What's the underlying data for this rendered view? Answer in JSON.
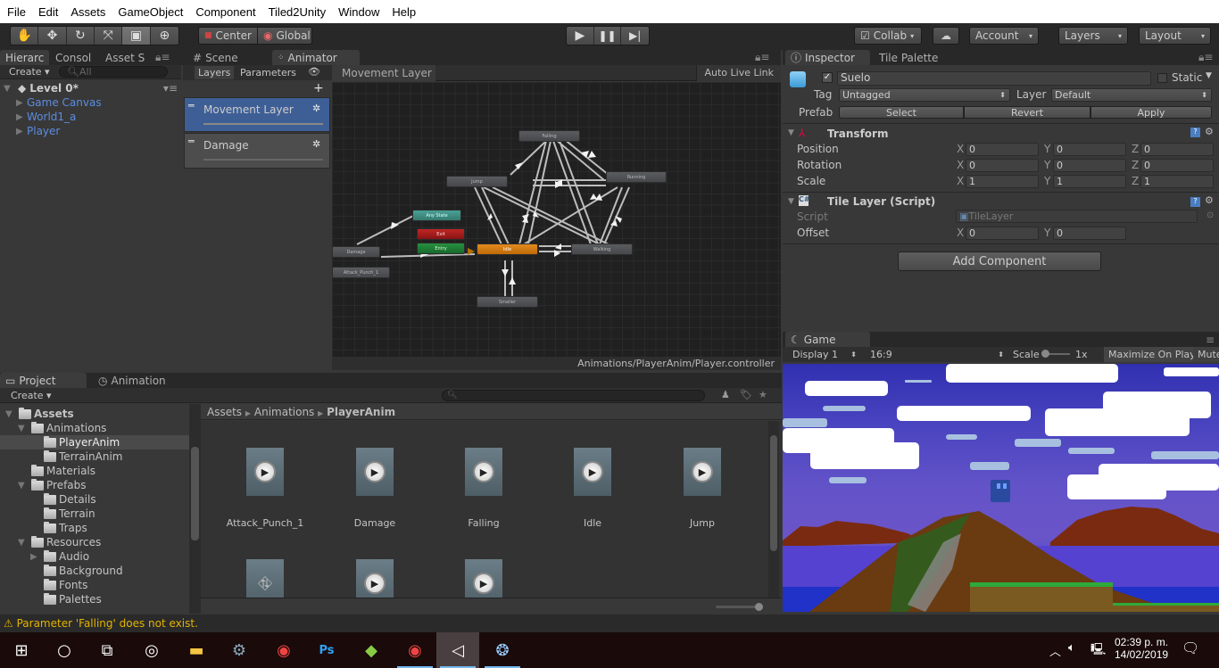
{
  "menu": [
    "File",
    "Edit",
    "Assets",
    "GameObject",
    "Component",
    "Tiled2Unity",
    "Window",
    "Help"
  ],
  "toolbar": {
    "tools": [
      "hand-tool",
      "move-tool",
      "rotate-tool",
      "scale-tool",
      "rect-tool",
      "transform-tool"
    ],
    "pivot_label": "Center",
    "space_label": "Global",
    "collab_label": "Collab",
    "account_label": "Account",
    "layers_label": "Layers",
    "layout_label": "Layout"
  },
  "hierarchy": {
    "tabs": [
      "Hierarc",
      "Consol",
      "Asset S"
    ],
    "create_label": "Create",
    "search_placeholder": "All",
    "scene_name": "Level 0*",
    "items": [
      "Game Canvas",
      "World1_a",
      "Player"
    ]
  },
  "animator": {
    "tabs": [
      "Scene",
      "Animator"
    ],
    "side_tabs": [
      "Layers",
      "Parameters"
    ],
    "layers": [
      {
        "name": "Movement Layer",
        "selected": true
      },
      {
        "name": "Damage",
        "selected": false
      }
    ],
    "breadcrumb": "Movement Layer",
    "auto_live_link": "Auto Live Link",
    "controller_path": "Animations/PlayerAnim/Player.controller",
    "states": {
      "falling": "Falling",
      "jump": "Jump",
      "running": "Running",
      "idle": "Idle",
      "walking": "Walking",
      "smaller": "Smaller",
      "any_state": "Any State",
      "exit": "Exit",
      "entry": "Entry",
      "damage": "Damage",
      "attack": "Attack_Punch_1"
    },
    "colors": {
      "default": "#4b4d50",
      "idle": "#d27a12",
      "any_state": "#3e8a80",
      "exit": "#a01c1c",
      "entry": "#1c7a30"
    }
  },
  "inspector": {
    "tabs": [
      "Inspector",
      "Tile Palette"
    ],
    "object_name": "Suelo",
    "active": true,
    "static_label": "Static",
    "tag_label": "Tag",
    "tag_value": "Untagged",
    "layer_label": "Layer",
    "layer_value": "Default",
    "prefab_label": "Prefab",
    "prefab_buttons": [
      "Select",
      "Revert",
      "Apply"
    ],
    "transform": {
      "title": "Transform",
      "rows": [
        {
          "label": "Position",
          "x": "0",
          "y": "0",
          "z": "0"
        },
        {
          "label": "Rotation",
          "x": "0",
          "y": "0",
          "z": "0"
        },
        {
          "label": "Scale",
          "x": "1",
          "y": "1",
          "z": "1"
        }
      ]
    },
    "tile_layer": {
      "title": "Tile Layer (Script)",
      "script_label": "Script",
      "script_value": "TileLayer",
      "offset_label": "Offset",
      "offset_x": "0",
      "offset_y": "0"
    },
    "add_component": "Add Component"
  },
  "game": {
    "tab": "Game",
    "display": "Display 1",
    "aspect": "16:9",
    "scale_label": "Scale",
    "scale_value": "1x",
    "maximize": "Maximize On Play",
    "mute": "Mute"
  },
  "project": {
    "tabs": [
      "Project",
      "Animation"
    ],
    "create_label": "Create",
    "tree": [
      {
        "label": "Assets",
        "depth": 0,
        "expanded": true,
        "bold": true
      },
      {
        "label": "Animations",
        "depth": 1,
        "expanded": true
      },
      {
        "label": "PlayerAnim",
        "depth": 2,
        "selected": true
      },
      {
        "label": "TerrainAnim",
        "depth": 2
      },
      {
        "label": "Materials",
        "depth": 1
      },
      {
        "label": "Prefabs",
        "depth": 1,
        "expanded": true
      },
      {
        "label": "Details",
        "depth": 2
      },
      {
        "label": "Terrain",
        "depth": 2
      },
      {
        "label": "Traps",
        "depth": 2
      },
      {
        "label": "Resources",
        "depth": 1,
        "expanded": true
      },
      {
        "label": "Audio",
        "depth": 2,
        "collapsed": true
      },
      {
        "label": "Background",
        "depth": 2
      },
      {
        "label": "Fonts",
        "depth": 2
      },
      {
        "label": "Palettes",
        "depth": 2
      }
    ],
    "breadcrumb": [
      "Assets",
      "Animations",
      "PlayerAnim"
    ],
    "assets": [
      "Attack_Punch_1",
      "Damage",
      "Falling",
      "Idle",
      "Jump"
    ],
    "assets_row2": [
      "animator-controller",
      "animation-clip",
      "animation-clip"
    ]
  },
  "status": {
    "warning": "Parameter 'Falling' does not exist."
  },
  "taskbar": {
    "apps": [
      "start",
      "cortana-search",
      "task-view",
      "groove",
      "file-explorer",
      "steam",
      "chrome",
      "photoshop",
      "aseprite",
      "chrome",
      "unity",
      "tiled"
    ],
    "time": "02:39 p. m.",
    "date": "14/02/2019"
  }
}
